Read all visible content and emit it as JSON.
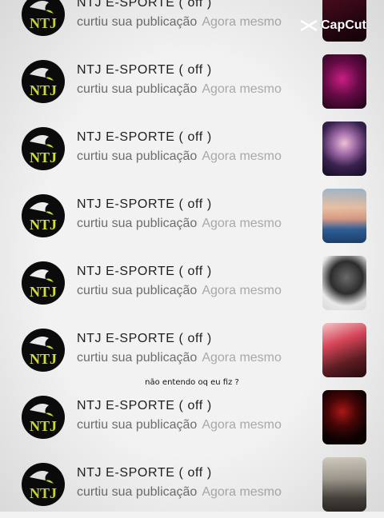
{
  "watermark": {
    "text": "CapCut",
    "icon": "capcut-logo-icon"
  },
  "colors": {
    "background": "#f2f2f2",
    "name": "#1e1e1e",
    "action": "#6d6d6d",
    "time": "#a9a9a9",
    "avatar_accent": "#d4e22b"
  },
  "notifications": [
    {
      "name": "NTJ  E-SPORTE  ( off )",
      "action": "curtiu sua publicação",
      "time": "Agora mesmo",
      "avatar_text": "NTJ"
    },
    {
      "name": "NTJ  E-SPORTE  ( off )",
      "action": "curtiu sua publicação",
      "time": "Agora mesmo",
      "avatar_text": "NTJ"
    },
    {
      "name": "NTJ  E-SPORTE  ( off )",
      "action": "curtiu sua publicação",
      "time": "Agora mesmo",
      "avatar_text": "NTJ"
    },
    {
      "name": "NTJ  E-SPORTE  ( off )",
      "action": "curtiu sua publicação",
      "time": "Agora mesmo",
      "avatar_text": "NTJ"
    },
    {
      "name": "NTJ  E-SPORTE  ( off )",
      "action": "curtiu sua publicação",
      "time": "Agora mesmo",
      "avatar_text": "NTJ"
    },
    {
      "name": "NTJ  E-SPORTE  ( off )",
      "action": "curtiu sua publicação",
      "time": "Agora mesmo",
      "avatar_text": "NTJ"
    },
    {
      "name": "NTJ  E-SPORTE  ( off )",
      "action": "curtiu sua publicação",
      "time": "Agora mesmo",
      "avatar_text": "NTJ"
    },
    {
      "name": "NTJ  E-SPORTE  ( off )",
      "action": "curtiu sua publicação",
      "time": "Agora mesmo",
      "avatar_text": "NTJ"
    }
  ],
  "caption": "não entendo oq eu fiz ?"
}
